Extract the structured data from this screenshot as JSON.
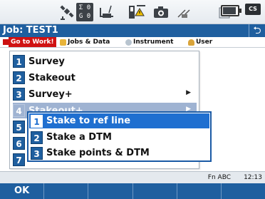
{
  "status_bar": {
    "counter_top": "Σ 0",
    "counter_bottom": "G 0",
    "cs_badge": "CS",
    "icons": [
      "satellite-icon",
      "radio-icon",
      "total-station-icon",
      "camera-icon",
      "antenna-icon",
      "battery-icon"
    ]
  },
  "title_bar": {
    "title": "Job: TEST1",
    "back_icon": "back-arrow-icon"
  },
  "menu_bar": {
    "go_to_work": "Go to Work!",
    "jobs_data": "Jobs & Data",
    "instrument": "Instrument",
    "user": "User"
  },
  "main_menu": {
    "items": [
      {
        "num": "1",
        "label": "Survey",
        "has_submenu": false
      },
      {
        "num": "2",
        "label": "Stakeout",
        "has_submenu": false
      },
      {
        "num": "3",
        "label": "Survey+",
        "has_submenu": true
      },
      {
        "num": "4",
        "label": "Stakeout+",
        "has_submenu": true
      },
      {
        "num": "5",
        "label": "",
        "has_submenu": false
      },
      {
        "num": "6",
        "label": "",
        "has_submenu": false
      },
      {
        "num": "7",
        "label": "",
        "has_submenu": false
      }
    ],
    "highlighted": 4
  },
  "submenu": {
    "items": [
      {
        "num": "1",
        "label": "Stake to ref line"
      },
      {
        "num": "2",
        "label": "Stake a DTM"
      },
      {
        "num": "3",
        "label": "Stake points & DTM"
      }
    ],
    "selected": 1
  },
  "info_bar": {
    "fn_abc": "Fn ABC",
    "time": "12:13"
  },
  "softkeys": [
    "OK",
    "",
    "",
    "",
    "",
    ""
  ],
  "colors": {
    "title_bar": "#1f5f9f",
    "selection": "#1f6fd0",
    "highlight": "#9fb3d2",
    "go_to_work": "#d01212"
  }
}
